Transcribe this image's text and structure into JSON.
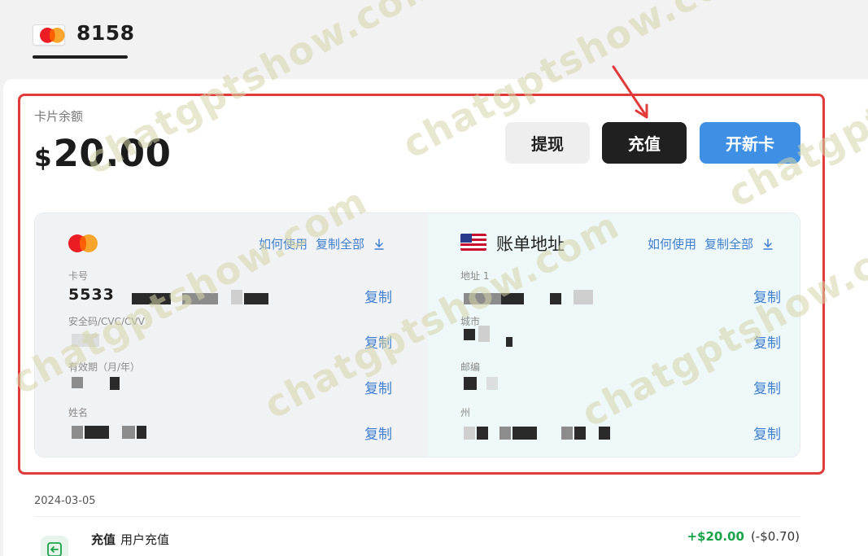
{
  "tab": {
    "card_number": "8158"
  },
  "balance": {
    "label": "卡片余额",
    "currency": "$",
    "amount": "20.00"
  },
  "actions": {
    "withdraw": "提现",
    "recharge": "充值",
    "new_card": "开新卡"
  },
  "card_panel": {
    "how_to_use": "如何使用",
    "copy_all": "复制全部",
    "fields": [
      {
        "label": "卡号",
        "value": "5533",
        "copy": "复制"
      },
      {
        "label": "安全码/CVC/CVV",
        "value": "",
        "copy": "复制"
      },
      {
        "label": "有效期（月/年）",
        "value": "",
        "copy": "复制"
      },
      {
        "label": "姓名",
        "value": "",
        "copy": "复制"
      }
    ]
  },
  "address_panel": {
    "title": "账单地址",
    "how_to_use": "如何使用",
    "copy_all": "复制全部",
    "fields": [
      {
        "label": "地址 1",
        "copy": "复制"
      },
      {
        "label": "城市",
        "copy": "复制"
      },
      {
        "label": "邮编",
        "copy": "复制"
      },
      {
        "label": "州",
        "copy": "复制"
      }
    ]
  },
  "transactions": {
    "date": "2024-03-05",
    "items": [
      {
        "type": "充值",
        "desc": "用户充值",
        "amount": "+$20.00",
        "fee": "(-$0.70)"
      }
    ]
  },
  "watermark_text": "chatgptshow.com",
  "colors": {
    "primary_blue": "#3f8fe4",
    "highlight_red": "#e23b3b",
    "success_green": "#1aa34a"
  }
}
